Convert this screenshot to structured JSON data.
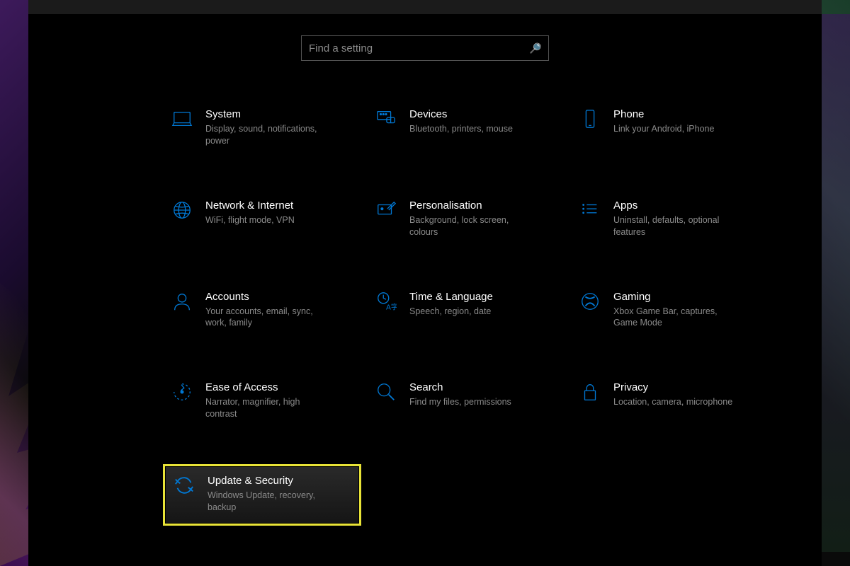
{
  "search": {
    "placeholder": "Find a setting"
  },
  "categories": [
    {
      "id": "system",
      "title": "System",
      "desc": "Display, sound, notifications, power"
    },
    {
      "id": "devices",
      "title": "Devices",
      "desc": "Bluetooth, printers, mouse"
    },
    {
      "id": "phone",
      "title": "Phone",
      "desc": "Link your Android, iPhone"
    },
    {
      "id": "network",
      "title": "Network & Internet",
      "desc": "WiFi, flight mode, VPN"
    },
    {
      "id": "personalisation",
      "title": "Personalisation",
      "desc": "Background, lock screen, colours"
    },
    {
      "id": "apps",
      "title": "Apps",
      "desc": "Uninstall, defaults, optional features"
    },
    {
      "id": "accounts",
      "title": "Accounts",
      "desc": "Your accounts, email, sync, work, family"
    },
    {
      "id": "time",
      "title": "Time & Language",
      "desc": "Speech, region, date"
    },
    {
      "id": "gaming",
      "title": "Gaming",
      "desc": "Xbox Game Bar, captures, Game Mode"
    },
    {
      "id": "ease",
      "title": "Ease of Access",
      "desc": "Narrator, magnifier, high contrast"
    },
    {
      "id": "search",
      "title": "Search",
      "desc": "Find my files, permissions"
    },
    {
      "id": "privacy",
      "title": "Privacy",
      "desc": "Location, camera, microphone"
    },
    {
      "id": "update",
      "title": "Update & Security",
      "desc": "Windows Update, recovery, backup",
      "highlighted": true
    }
  ],
  "colors": {
    "accent": "#0078d4",
    "highlight_border": "#e8e337",
    "text_primary": "#ffffff",
    "text_secondary": "#8a8a8a"
  }
}
